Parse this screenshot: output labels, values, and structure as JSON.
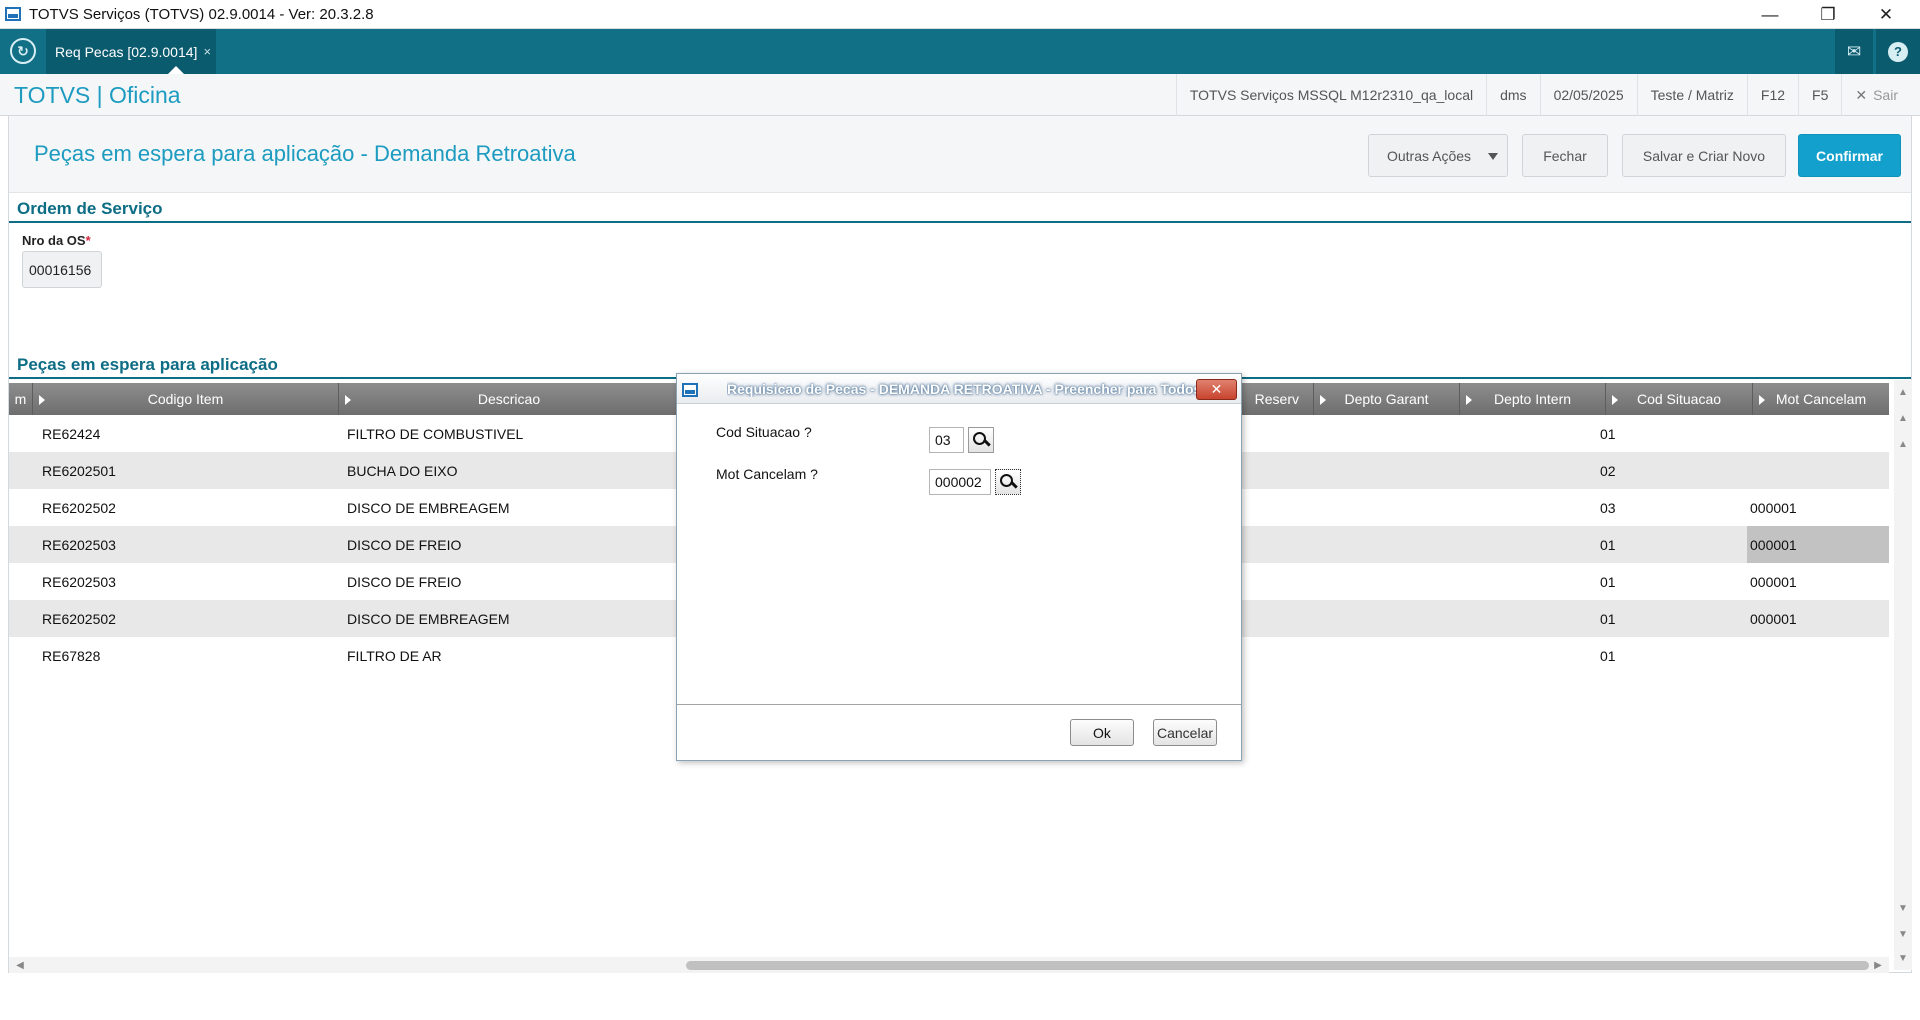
{
  "window": {
    "title": "TOTVS Serviços (TOTVS) 02.9.0014 - Ver: 20.3.2.8",
    "minimize_glyph": "—",
    "restore_glyph": "❐",
    "close_glyph": "✕"
  },
  "tabbar": {
    "home_glyph": "↻",
    "tab_label": "Req Pecas [02.9.0014]",
    "tab_close": "×",
    "mail_glyph": "✉",
    "help_glyph": "?"
  },
  "app_header": {
    "brand": "TOTVS | Oficina",
    "environment": "TOTVS Serviços MSSQL M12r2310_qa_local",
    "module": "dms",
    "date": "02/05/2025",
    "company": "Teste / Matriz",
    "key_f12": "F12",
    "key_f5": "F5",
    "sair_icon": "✕",
    "sair": "Sair"
  },
  "page": {
    "title": "Peças em espera para aplicação - Demanda Retroativa",
    "buttons": {
      "outras_acoes": "Outras Ações",
      "fechar": "Fechar",
      "salvar_criar_novo": "Salvar e Criar Novo",
      "confirmar": "Confirmar"
    }
  },
  "ordem_servico": {
    "section_title": "Ordem de Serviço",
    "nro_os_label": "Nro da OS",
    "required_mark": "*",
    "nro_os_value": "00016156"
  },
  "pecas": {
    "section_title": "Peças em espera para aplicação",
    "columns": {
      "col0": "m",
      "codigo_item": "Codigo Item",
      "descricao": "Descricao",
      "reserv": "Reserv",
      "depto_garant": "Depto Garant",
      "depto_intern": "Depto Intern",
      "cod_situacao": "Cod Situacao",
      "mot_cancelam": "Mot Cancelam"
    },
    "rows": [
      {
        "codigo": "RE62424",
        "descricao": "FILTRO DE COMBUSTIVEL",
        "cod_situacao": "01",
        "mot_cancelam": ""
      },
      {
        "codigo": "RE6202501",
        "descricao": "BUCHA DO EIXO",
        "cod_situacao": "02",
        "mot_cancelam": ""
      },
      {
        "codigo": "RE6202502",
        "descricao": "DISCO DE EMBREAGEM",
        "cod_situacao": "03",
        "mot_cancelam": "000001"
      },
      {
        "codigo": "RE6202503",
        "descricao": "DISCO DE FREIO",
        "cod_situacao": "01",
        "mot_cancelam": "000001"
      },
      {
        "codigo": "RE6202503",
        "descricao": "DISCO DE FREIO",
        "cod_situacao": "01",
        "mot_cancelam": "000001"
      },
      {
        "codigo": "RE6202502",
        "descricao": "DISCO DE EMBREAGEM",
        "cod_situacao": "01",
        "mot_cancelam": "000001"
      },
      {
        "codigo": "RE67828",
        "descricao": "FILTRO DE AR",
        "cod_situacao": "01",
        "mot_cancelam": ""
      }
    ],
    "selected_row_index": 3
  },
  "scroll": {
    "up_glyph": "▲",
    "down_glyph": "▼",
    "left_glyph": "◀",
    "right_glyph": "▶"
  },
  "dialog": {
    "title": "Requisicao de Pecas - DEMANDA RETROATIVA - Preencher para Todos",
    "close_glyph": "✕",
    "cod_situacao_label": "Cod Situacao ?",
    "cod_situacao_value": "03",
    "mot_cancelam_label": "Mot Cancelam ?",
    "mot_cancelam_value": "000002",
    "ok": "Ok",
    "cancelar": "Cancelar"
  }
}
